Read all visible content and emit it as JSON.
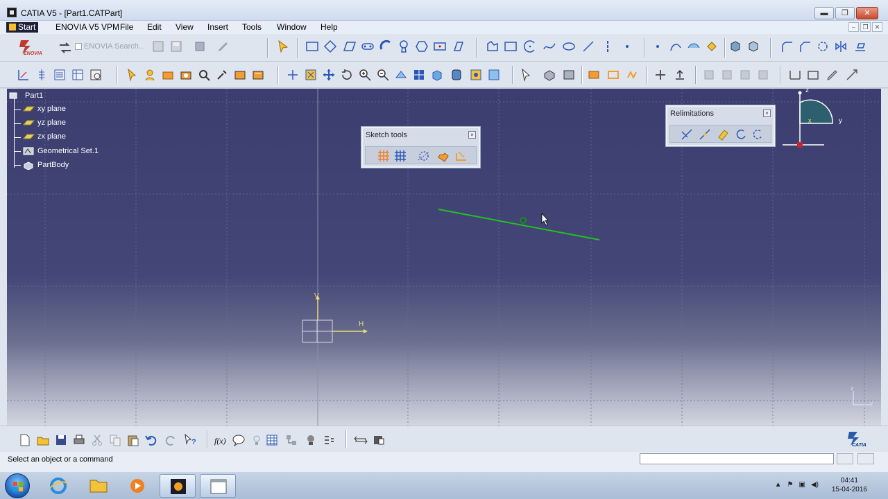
{
  "window": {
    "title": "CATIA V5 - [Part1.CATPart]",
    "min_label": "▬",
    "max_label": "❐",
    "close_label": "✕"
  },
  "menubar": {
    "items": [
      "Start",
      "ENOVIA V5 VPM",
      "File",
      "Edit",
      "View",
      "Insert",
      "Tools",
      "Window",
      "Help"
    ],
    "mdi": [
      "–",
      "❐",
      "✕"
    ]
  },
  "toolbar": {
    "enovia_logo_text": "ENOVIA",
    "enovia_search_placeholder": "ENOVIA Search..."
  },
  "tree": {
    "root": "Part1",
    "items": [
      "xy plane",
      "yz plane",
      "zx plane",
      "Geometrical Set.1",
      "PartBody"
    ]
  },
  "sketch_tools": {
    "title": "Sketch tools",
    "close": "×"
  },
  "relimitations": {
    "title": "Relimitations",
    "close": "×"
  },
  "compass": {
    "z": "z",
    "y": "y",
    "x": "x"
  },
  "axis_labels": {
    "h": "H",
    "v": "V"
  },
  "corner_axis": {
    "z": "z",
    "y": "y"
  },
  "bottombar": {
    "catia_logo_text": "CATIA"
  },
  "statusbar": {
    "message": "Select an object or a command",
    "command_value": ""
  },
  "taskbar": {
    "time": "04:41",
    "date": "15-04-2016"
  },
  "colors": {
    "canvas_top": "#3b3e6f",
    "sketch_line": "#22c022",
    "axis_yellow": "#e8e070"
  }
}
